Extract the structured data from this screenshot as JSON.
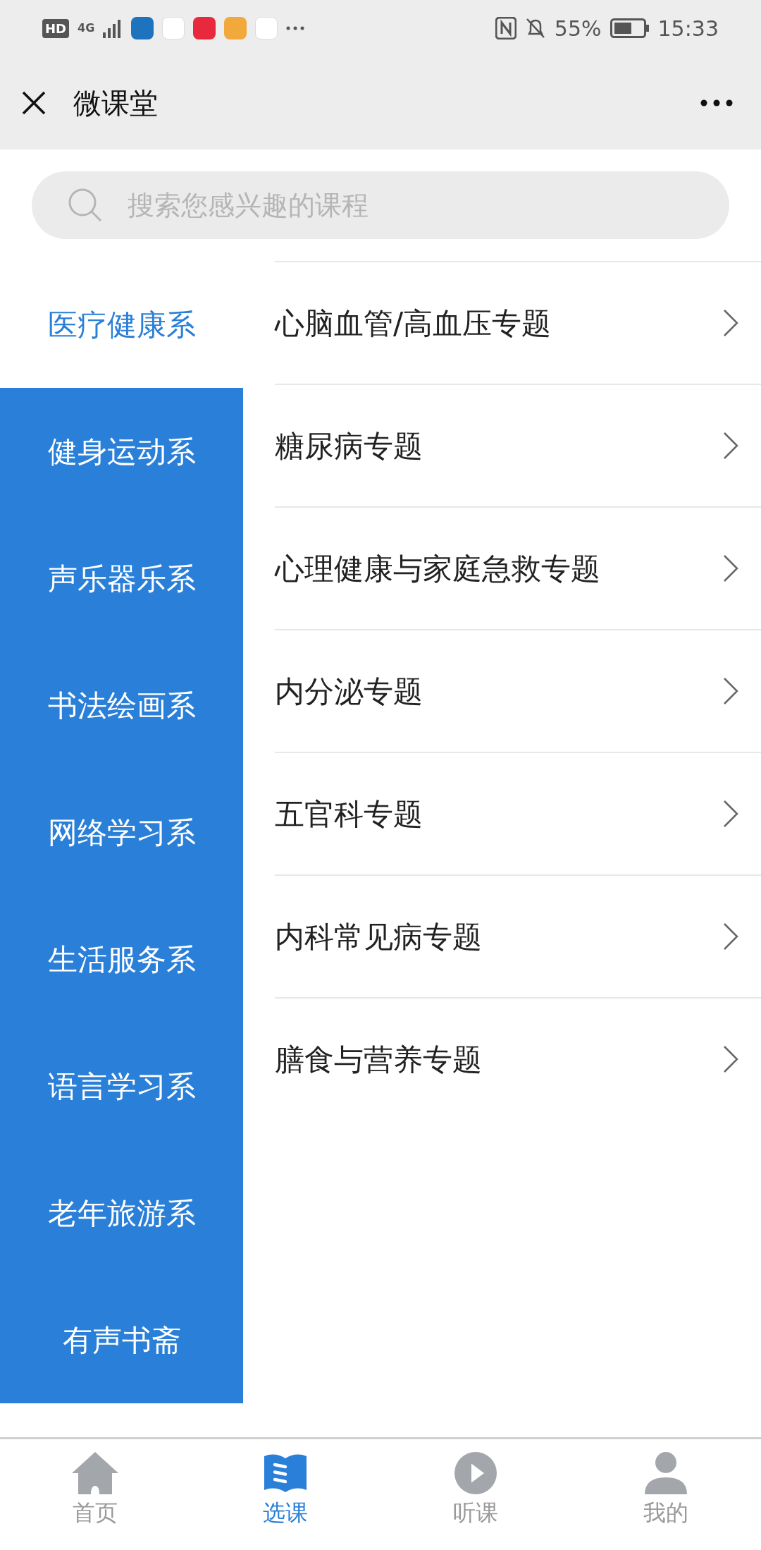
{
  "status_bar": {
    "hd": "HD",
    "network": "4G",
    "battery": "55%",
    "time": "15:33"
  },
  "header": {
    "title": "微课堂"
  },
  "search": {
    "placeholder": "搜索您感兴趣的课程"
  },
  "categories": [
    {
      "label": "医疗健康系",
      "selected": true
    },
    {
      "label": "健身运动系",
      "selected": false
    },
    {
      "label": "声乐器乐系",
      "selected": false
    },
    {
      "label": "书法绘画系",
      "selected": false
    },
    {
      "label": "网络学习系",
      "selected": false
    },
    {
      "label": "生活服务系",
      "selected": false
    },
    {
      "label": "语言学习系",
      "selected": false
    },
    {
      "label": "老年旅游系",
      "selected": false
    },
    {
      "label": "有声书斋",
      "selected": false
    }
  ],
  "topics": [
    "心脑血管/高血压专题",
    "糖尿病专题",
    "心理健康与家庭急救专题",
    "内分泌专题",
    "五官科专题",
    "内科常见病专题",
    "膳食与营养专题"
  ],
  "tab_bar": [
    {
      "label": "首页",
      "kind": "home",
      "selected": false
    },
    {
      "label": "选课",
      "kind": "book",
      "selected": true
    },
    {
      "label": "听课",
      "kind": "play",
      "selected": false
    },
    {
      "label": "我的",
      "kind": "person",
      "selected": false
    }
  ]
}
